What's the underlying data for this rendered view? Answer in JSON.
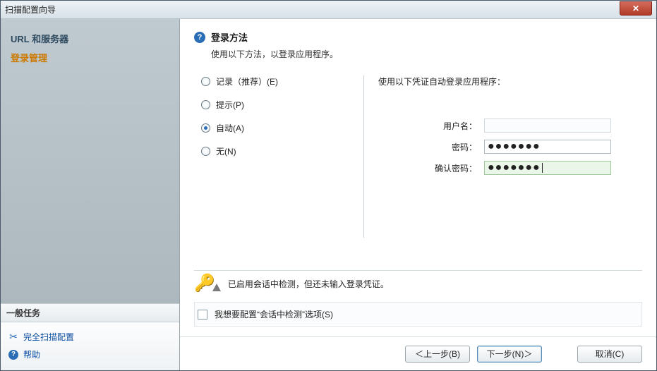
{
  "window": {
    "title": "扫描配置向导"
  },
  "sidebar": {
    "steps": [
      {
        "label": "URL 和服务器"
      },
      {
        "label": "登录管理"
      }
    ],
    "tasks_header": "一般任务",
    "tasks": {
      "full_config": "完全扫描配置",
      "help": "帮助"
    }
  },
  "page": {
    "heading": "登录方法",
    "subtitle": "使用以下方法，以登录应用程序。",
    "radios": {
      "record": "记录（推荐）(E)",
      "prompt": "提示(P)",
      "auto": "自动(A)",
      "none": "无(N)"
    },
    "right_label": "使用以下凭证自动登录应用程序：",
    "fields": {
      "username_label": "用户名：",
      "username_value": "",
      "password_label": "密码：",
      "confirm_label": "确认密码："
    },
    "warning": "已启用会话中检测，但还未输入登录凭证。",
    "checkbox_label": "我想要配置“会话中检测”选项(S)"
  },
  "footer": {
    "back": "＜上一步(B)",
    "next": "下一步(N)＞",
    "cancel": "取消(C)"
  }
}
